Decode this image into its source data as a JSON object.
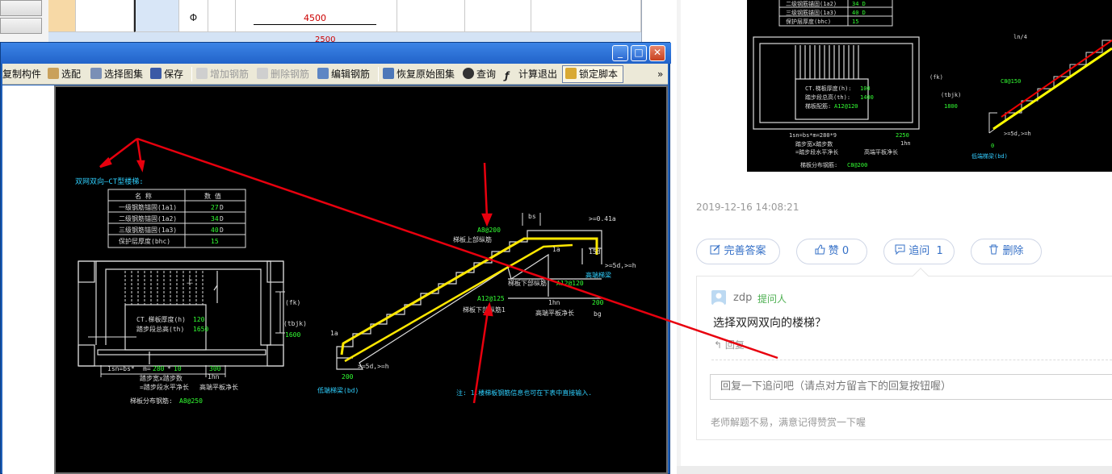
{
  "bg_app": {
    "row_symbol": "Φ",
    "row_value": "4500",
    "row_cut_value": "2500"
  },
  "window": {
    "minimize_glyph": "_",
    "maximize_glyph": "□",
    "close_glyph": "✕",
    "overflow_glyph": "»"
  },
  "toolbar": {
    "copy_label": "复制构件",
    "select_label": "选配",
    "choose_atlas_label": "选择图集",
    "save_label": "保存",
    "add_rebar_label": "增加钢筋",
    "delete_rebar_label": "删除钢筋",
    "edit_rebar_label": "编辑钢筋",
    "restore_label": "恢复原始图集",
    "query_label": "查询",
    "calc_exit_label": "计算退出",
    "lock_script_label": "锁定脚本"
  },
  "drawing": {
    "title": "双网双向—CT型楼梯:",
    "table": {
      "headers": [
        "名 称",
        "数 值"
      ],
      "rows": [
        {
          "name": "一级钢筋锚固(1a1)",
          "value": "27",
          "unit": "D"
        },
        {
          "name": "二级钢筋锚固(1a2)",
          "value": "34",
          "unit": "D"
        },
        {
          "name": "三级钢筋锚固(1a3)",
          "value": "40",
          "unit": "D"
        },
        {
          "name": "保护层厚度(bhc)",
          "value": "15",
          "unit": ""
        }
      ]
    },
    "plan": {
      "thickness_label": "CT.梯板厚度(h)",
      "thickness_value": "120",
      "step_height_label": "踏步段总高(th)",
      "step_height_value": "1650",
      "fk_label": "(fk)",
      "tbjk_label": "(tbjk)",
      "tbjk_value": "1600",
      "up_mark": "上",
      "formula_prefix": "1sn=bs*",
      "formula_m": "m=",
      "formula_bs": "280",
      "formula_mult": "*",
      "formula_m_value": "10",
      "formula_right": "300",
      "step_note1": "踏步宽x踏步数",
      "step_note2": "=踏步段水平净长",
      "landing_note": "高端平板净长",
      "lhn": "1hn",
      "dist_rebar_label": "梯板分布钢筋:",
      "dist_rebar_value": "A8@250"
    },
    "section": {
      "top_rebar_value": "A8@200",
      "top_rebar_label": "梯板上部纵筋",
      "bottom_rebar_label": "梯板下部纵筋",
      "bottom_rebar_value": "A12@120",
      "mid_rebar_value": "A12@125",
      "mid_rebar_label": "梯板下部纵筋1",
      "bs": "bs",
      "la": "1a",
      "d041": ">=0.41a",
      "d15": "15d",
      "d5d": ">=5d,>=h",
      "high_end": "高端梯梁",
      "low_end": "低端梯梁(bd)",
      "lhn": "1hn",
      "landing_len": "高端平板净长",
      "d200_top": "200",
      "bg": "bg",
      "d200_bottom": "200",
      "low_5d": ">=5d,>=h",
      "note": "注: 1.楼梯板钢筋信息也可在下表中直接输入."
    },
    "annotation_color": "#e8000e"
  },
  "question": {
    "timestamp": "2019-12-16 14:08:21",
    "actions": {
      "improve_label": "完善答案",
      "like_label": "赞 0",
      "followup_label": "追问",
      "followup_count": "1",
      "delete_label": "删除"
    },
    "reply": {
      "username": "zdp",
      "role": "提问人",
      "message": "选择双网双向的楼梯？",
      "reply_link": "回复",
      "input_placeholder": "回复一下追问吧（请点对方留言下的回复按钮喔）",
      "footer_note": "老师解题不易，满意记得赞赏一下喔"
    },
    "thumb": {
      "rows": [
        {
          "name": "二级钢筋锚固(1a2)",
          "value": "34 D"
        },
        {
          "name": "三级钢筋锚固(1a3)",
          "value": "40 D"
        },
        {
          "name": "保护层厚度(bhc)",
          "value": "15"
        }
      ],
      "thickness_label": "CT.梯板厚度(h):",
      "thickness_value": "100",
      "step_height_label": "踏步段总高(th):",
      "step_height_value": "1400",
      "rebar_label": "梯板配筋:",
      "rebar_value": "A12@120",
      "fk_label": "(fk)",
      "tbjk_label": "(tbjk)",
      "tbjk_value": "1800",
      "formula": "1sn=bs*m=280*9",
      "formula_right": "2250",
      "step_note1": "踏步宽x踏步数",
      "step_note2": "=踏步段水平净长",
      "landing_note": "高端平板净长",
      "lhn": "1hn",
      "dist_rebar_label": "梯板分布钢筋:",
      "dist_rebar_value": "C8@200",
      "ln4": "ln/4",
      "c8": "C8@150",
      "d5d": ">=5d,>=h",
      "d0": "0",
      "low_end": "低端梯梁(bd)"
    }
  }
}
